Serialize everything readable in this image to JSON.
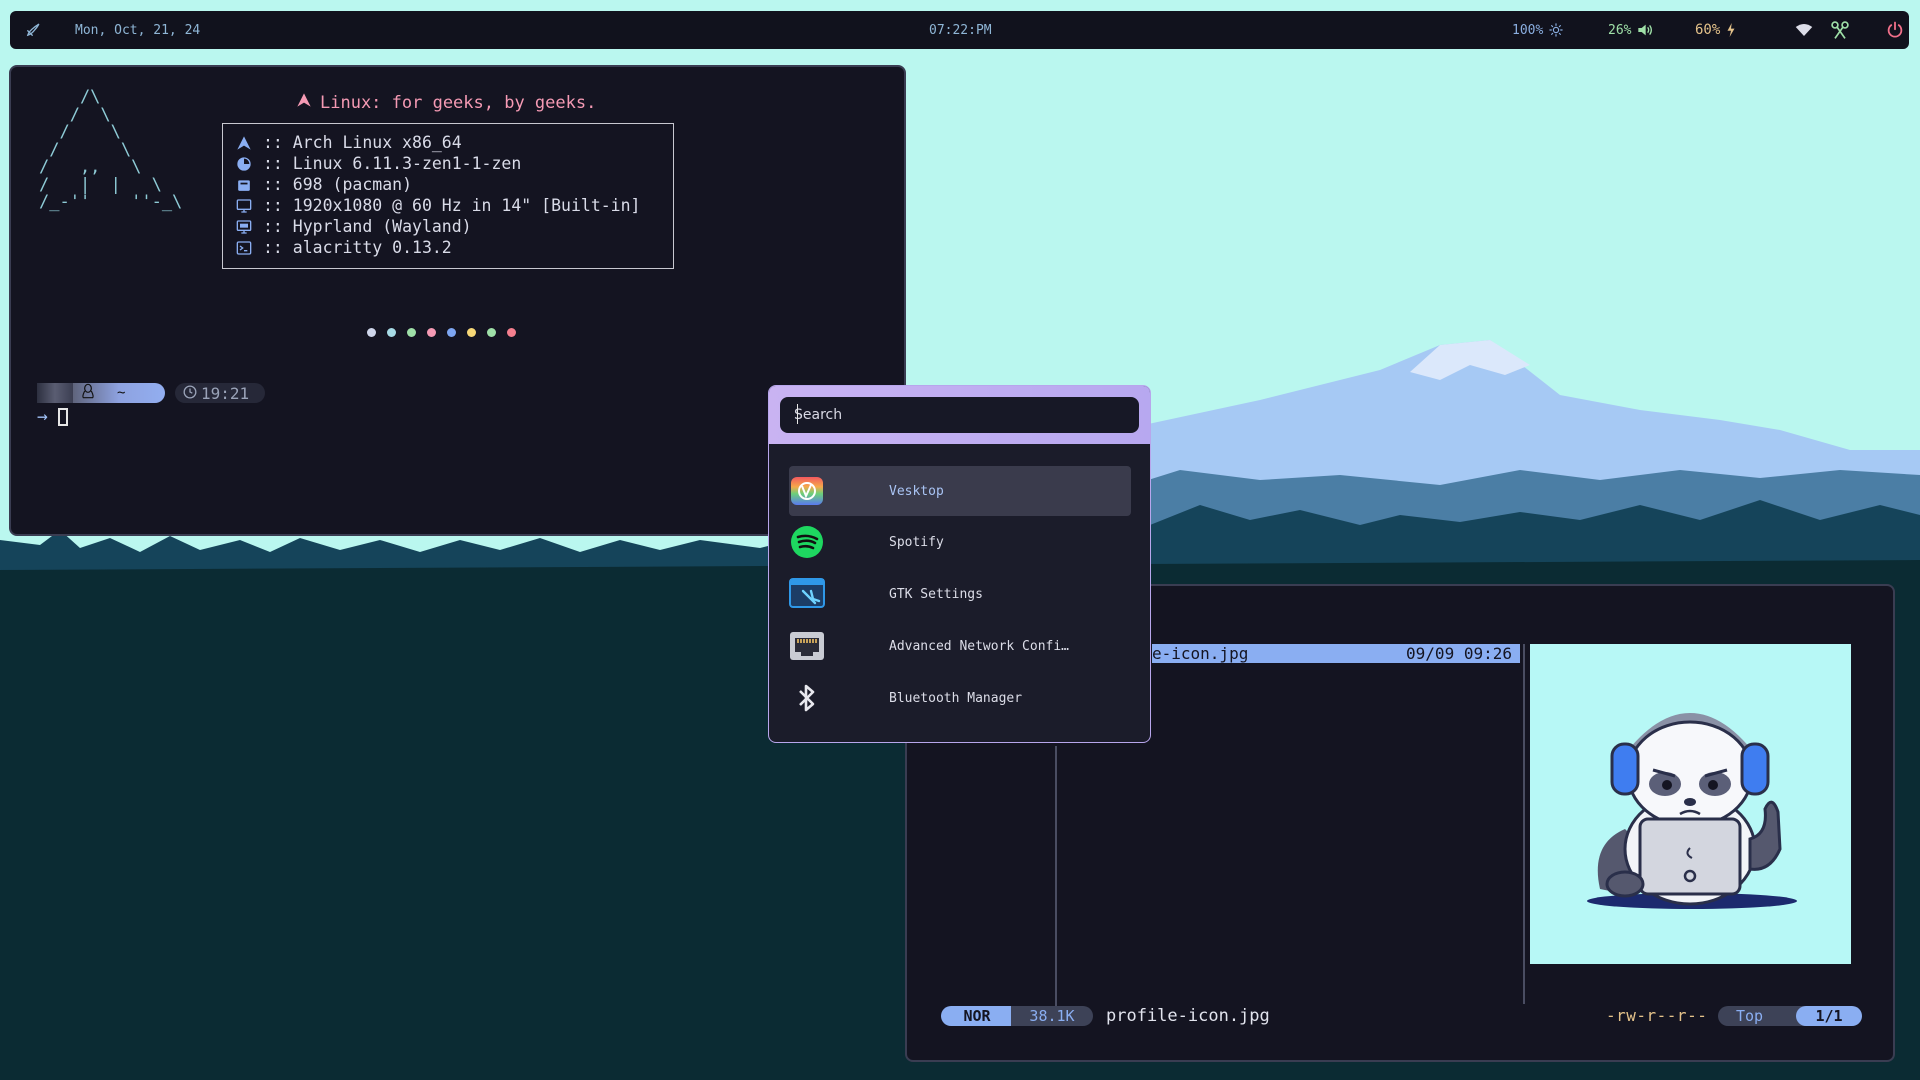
{
  "topbar": {
    "launcher_icon": "rocket-icon",
    "date": "Mon, Oct, 21, 24",
    "time": "07:22:PM",
    "brightness": "100%",
    "brightness_icon": "sun-icon",
    "volume": "26%",
    "volume_icon": "speaker-icon",
    "battery": "60%",
    "battery_icon": "bolt-icon",
    "wifi_icon": "wifi-icon",
    "app_icon": "scissors-icon",
    "power_icon": "power-icon"
  },
  "terminal": {
    "ascii_art": "    /\\\n   /  \\\n  /    \\\n /      \\\n/   ,,   \\\n/   |  |   \\\n/_-''    ''-_\\",
    "tagline": "Linux: for geeks, by geeks.",
    "info": [
      {
        "icon": "arch-logo-icon",
        "text": ":: Arch Linux x86_64"
      },
      {
        "icon": "kernel-icon",
        "text": ":: Linux 6.11.3-zen1-1-zen"
      },
      {
        "icon": "package-icon",
        "text": ":: 698 (pacman)"
      },
      {
        "icon": "monitor-icon",
        "text": ":: 1920x1080 @ 60 Hz in 14\" [Built-in]"
      },
      {
        "icon": "desktop-icon",
        "text": ":: Hyprland (Wayland)"
      },
      {
        "icon": "terminal-icon",
        "text": ":: alacritty 0.13.2"
      }
    ],
    "palette": [
      "#cfd6ea",
      "#a7dbe6",
      "#9fe0a8",
      "#f59ab4",
      "#7ea6f2",
      "#f7d877",
      "#9fe0a8",
      "#f57f8e"
    ],
    "prompt": {
      "user_icon": "tux-icon",
      "dir": "~",
      "clock_icon": "clock-icon",
      "time": "19:21",
      "arrow": "→"
    }
  },
  "launcher": {
    "search_placeholder": "Search",
    "entries": [
      {
        "label": "Vesktop",
        "icon": "vesktop-icon",
        "active": true
      },
      {
        "label": "Spotify",
        "icon": "spotify-icon",
        "active": false
      },
      {
        "label": "GTK Settings",
        "icon": "gtk-settings-icon",
        "active": false
      },
      {
        "label": "Advanced Network Confi…",
        "icon": "network-icon",
        "active": false
      },
      {
        "label": "Bluetooth Manager",
        "icon": "bluetooth-icon",
        "active": false
      }
    ]
  },
  "file_manager": {
    "selected_name": "e-icon.jpg",
    "selected_date": "09/09 09:26",
    "preview_image": "panda-with-headphones-illustration",
    "mode": "NOR",
    "size": "38.1K",
    "filename": "profile-icon.jpg",
    "permissions": "-rw-r--r--",
    "position_label": "Top",
    "position": "1/1"
  }
}
